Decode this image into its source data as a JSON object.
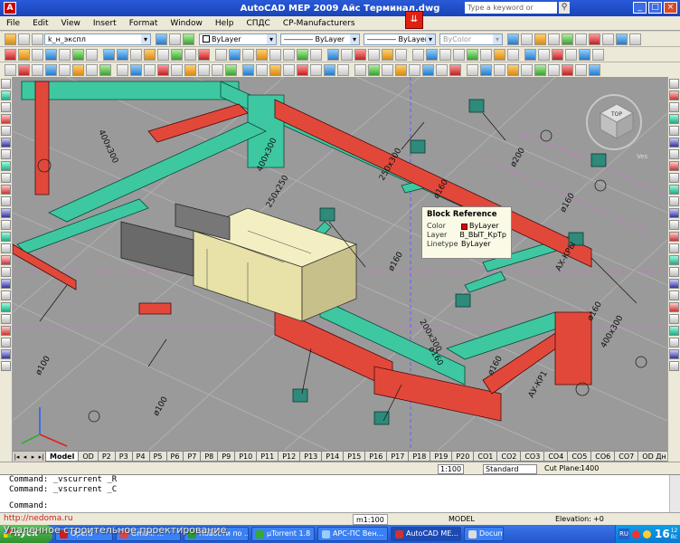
{
  "window": {
    "title": "AutoCAD MEP 2009 Айс Терминал.dwg",
    "app_icon": "A",
    "search_placeholder": "Type a keyword or phrase",
    "controls": [
      "_",
      "□",
      "×"
    ]
  },
  "menu": [
    "File",
    "Edit",
    "View",
    "Insert",
    "Format",
    "Window",
    "Help",
    "СПДС",
    "CP-Manufacturers"
  ],
  "toolbar1": {
    "layer_value": "k_н_экспл",
    "color_value": "ByLayer",
    "linetype_value": "ByLayer",
    "lineweight_value": "ByLayer",
    "plotstyle_value": "ByColor"
  },
  "colors": {
    "duct_supply": "#3ec8a2",
    "duct_exhaust": "#e2483a",
    "ahu_body": "#e8e2a8",
    "canvas_bg": "#9a9a9a",
    "tooltip_bg": "#fafae6"
  },
  "drawing_labels": {
    "vertical": [
      "400x300",
      "ø160",
      "ø160",
      "ø160",
      "ø200",
      "ø160",
      "ø100"
    ],
    "horizontal": [
      "400x300",
      "250x250",
      "250x300",
      "200x300",
      "400x300"
    ],
    "rotated": [
      "ø160",
      "ø100",
      "ø160",
      "АХ-КРЫ",
      "АУ-КР1"
    ]
  },
  "viewcube": {
    "face": "TOP",
    "label": "Ves"
  },
  "tooltip": {
    "title": "Block Reference",
    "rows": [
      {
        "key": "Color",
        "value": "ByLayer",
        "swatch": "#e00000"
      },
      {
        "key": "Layer",
        "value": "В_ВЫТ_КрТр"
      },
      {
        "key": "Linetype",
        "value": "ByLayer"
      }
    ]
  },
  "layout_tabs": [
    "Model",
    "OD",
    "P2",
    "P3",
    "P4",
    "P5",
    "P6",
    "P7",
    "P8",
    "P9",
    "P10",
    "P11",
    "P12",
    "P13",
    "P14",
    "P15",
    "P16",
    "P17",
    "P18",
    "P19",
    "P20",
    "CO1",
    "CO2",
    "CO3",
    "CO4",
    "CO5",
    "CO6",
    "CO7",
    "OD Дн"
  ],
  "active_tab": "Model",
  "scalebar": {
    "scale": "1:100",
    "style": "Standard",
    "cutplane_label": "Cut Plane:",
    "cutplane_value": "1400"
  },
  "command_lines": [
    "Command: _vscurrent _R",
    "Command: _vscurrent _C",
    "Command:"
  ],
  "statusbar": {
    "url": "http://nedoma.ru",
    "scale": "m1:100",
    "space": "MODEL",
    "elevation_label": "Elevation:",
    "elevation_value": "+0"
  },
  "caption_overlay": "Удаленное строительное проектирование",
  "taskbar": {
    "start": "пуск",
    "tasks": [
      {
        "label": "Opera",
        "color": "#cc2020"
      },
      {
        "label": "Gmail: ...",
        "color": "#d44"
      },
      {
        "label": "Новости по ...",
        "color": "#2a9a2a"
      },
      {
        "label": "µTorrent 1.8",
        "color": "#3a3"
      },
      {
        "label": "АРС-ПС Вен...",
        "color": "#9cf"
      },
      {
        "label": "AutoCAD МЕ...",
        "color": "#c33"
      },
      {
        "label": "Document...",
        "color": "#ddd"
      }
    ],
    "lang": "RU",
    "clock": "16",
    "clock_min": "12",
    "day": "Вс"
  }
}
